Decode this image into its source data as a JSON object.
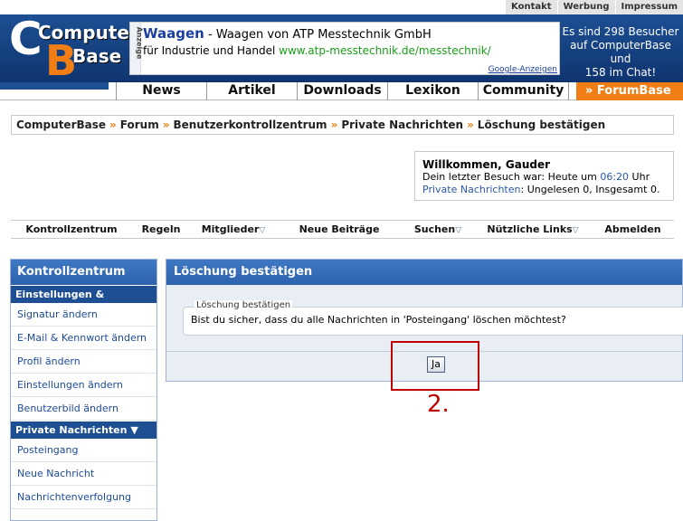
{
  "toplinks": [
    "Kontakt",
    "Werbung",
    "Impressum"
  ],
  "logo": {
    "line1": "Computer",
    "line2": "Base",
    "letter1": "C",
    "letter2": "B"
  },
  "ad": {
    "side_label": "Anzeige",
    "title": "Waagen",
    "title_rest": " - Waagen von ATP Messtechnik GmbH",
    "line2_text": "für Industrie und Handel ",
    "line2_link": "www.atp-messtechnik.de/messtechnik/",
    "footer": "Google-Anzeigen"
  },
  "chatinfo": {
    "line1": "Es sind 298 Besucher",
    "line2": "auf ComputerBase und",
    "line3": "158 im Chat!"
  },
  "mainnav": [
    "News",
    "Artikel",
    "Downloads",
    "Lexikon",
    "Community"
  ],
  "forumbase": "» ForumBase",
  "breadcrumb": [
    "ComputerBase",
    "Forum",
    "Benutzerkontrollzentrum",
    "Private Nachrichten",
    "Löschung bestätigen"
  ],
  "welcome": {
    "title": "Willkommen, Gauder",
    "visit_prefix": "Dein letzter Besuch war: Heute um ",
    "visit_time": "06:20",
    "visit_suffix": " Uhr",
    "pm_label": "Private Nachrichten",
    "pm_rest": ": Ungelesen 0, Insgesamt 0."
  },
  "subnav": [
    {
      "label": "Kontrollzentrum",
      "dropdown": false
    },
    {
      "label": "Regeln",
      "dropdown": false
    },
    {
      "label": "Mitglieder",
      "dropdown": true
    },
    {
      "label": "Neue Beiträge",
      "dropdown": false
    },
    {
      "label": "Suchen",
      "dropdown": true
    },
    {
      "label": "Nützliche Links",
      "dropdown": true
    },
    {
      "label": "Abmelden",
      "dropdown": false
    }
  ],
  "sidebar": {
    "title": "Kontrollzentrum",
    "section1": "Einstellungen & Optionen",
    "items1": [
      "Signatur ändern",
      "E-Mail & Kennwort ändern",
      "Profil ändern",
      "Einstellungen ändern",
      "Benutzerbild ändern"
    ],
    "section2": "Private Nachrichten",
    "items2": [
      "Posteingang",
      "Neue Nachricht",
      "Nachrichtenverfolgung"
    ]
  },
  "panel": {
    "title": "Löschung bestätigen",
    "legend": "Löschung bestätigen",
    "question": "Bist du sicher, dass du alle Nachrichten in 'Posteingang' löschen möchtest?",
    "button": "Ja"
  },
  "annotation": {
    "label": "2.",
    "color": "#c00000"
  },
  "colors": {
    "brand_blue": "#1d4f93",
    "accent_orange": "#f07e14",
    "link_blue": "#1c4a9a"
  }
}
